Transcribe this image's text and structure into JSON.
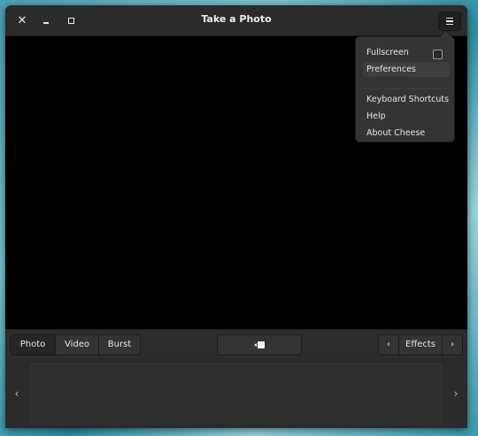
{
  "window": {
    "title": "Take a Photo"
  },
  "titlebar": {
    "close_icon": "✕",
    "menu_icon": "hamburger-icon"
  },
  "menu": {
    "items": [
      {
        "label": "Fullscreen"
      },
      {
        "label": "Preferences"
      },
      {
        "label": "Keyboard Shortcuts"
      },
      {
        "label": "Help"
      },
      {
        "label": "About Cheese"
      }
    ]
  },
  "modes": {
    "photo": "Photo",
    "video": "Video",
    "burst": "Burst",
    "selected": "Photo"
  },
  "effects": {
    "prev_icon": "‹",
    "label": "Effects",
    "next_icon": "›"
  },
  "thumbnails": {
    "prev_icon": "‹",
    "next_icon": "›"
  },
  "colors": {
    "window_bg": "#2b2b2b",
    "viewport_bg": "#000000",
    "text": "#e6e6e6"
  }
}
